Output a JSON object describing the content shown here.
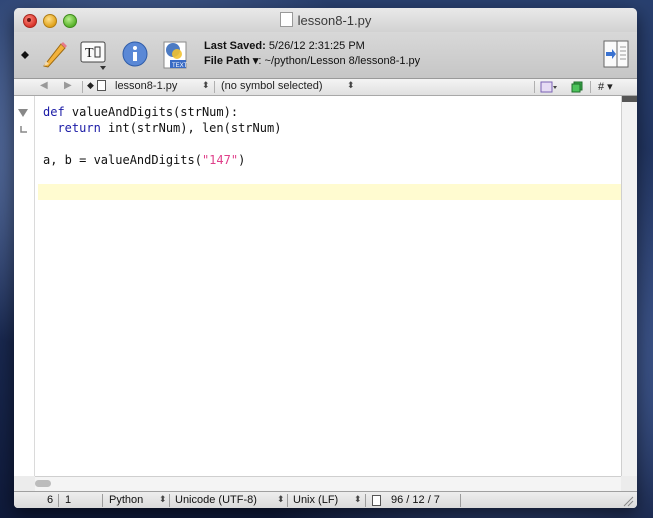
{
  "window": {
    "title": "lesson8-1.py"
  },
  "toolbar": {
    "last_saved_label": "Last Saved:",
    "last_saved_value": "5/26/12 2:31:25 PM",
    "file_path_label": "File Path",
    "file_path_value": ": ~/python/Lesson 8/lesson8-1.py",
    "icons": [
      "pencil-icon",
      "text-options-icon",
      "info-icon",
      "text-document-icon",
      "split-view-icon"
    ]
  },
  "navbar": {
    "file_name": "lesson8-1.py",
    "symbol": "(no symbol selected)",
    "hash": "#"
  },
  "editor": {
    "lines": [
      {
        "parts": [
          {
            "text": "def",
            "kind": "kw"
          },
          {
            "text": " valueAndDigits(strNum):",
            "kind": "plain"
          }
        ]
      },
      {
        "parts": [
          {
            "text": "  return",
            "kind": "kw"
          },
          {
            "text": " int(strNum), len(strNum)",
            "kind": "plain"
          }
        ]
      },
      {
        "parts": []
      },
      {
        "parts": [
          {
            "text": "a, b = valueAndDigits(",
            "kind": "plain"
          },
          {
            "text": "\"147\"",
            "kind": "str"
          },
          {
            "text": ")",
            "kind": "plain"
          }
        ]
      },
      {
        "parts": []
      },
      {
        "parts": []
      }
    ],
    "current_line": 6
  },
  "statusbar": {
    "line": "6",
    "column": "1",
    "language": "Python",
    "encoding": "Unicode (UTF-8)",
    "line_endings": "Unix (LF)",
    "counts": "96 / 12 / 7"
  },
  "colors": {
    "keyword": "#1a1aa6",
    "string": "#e03f8a",
    "current_line": "#fffbd0"
  }
}
